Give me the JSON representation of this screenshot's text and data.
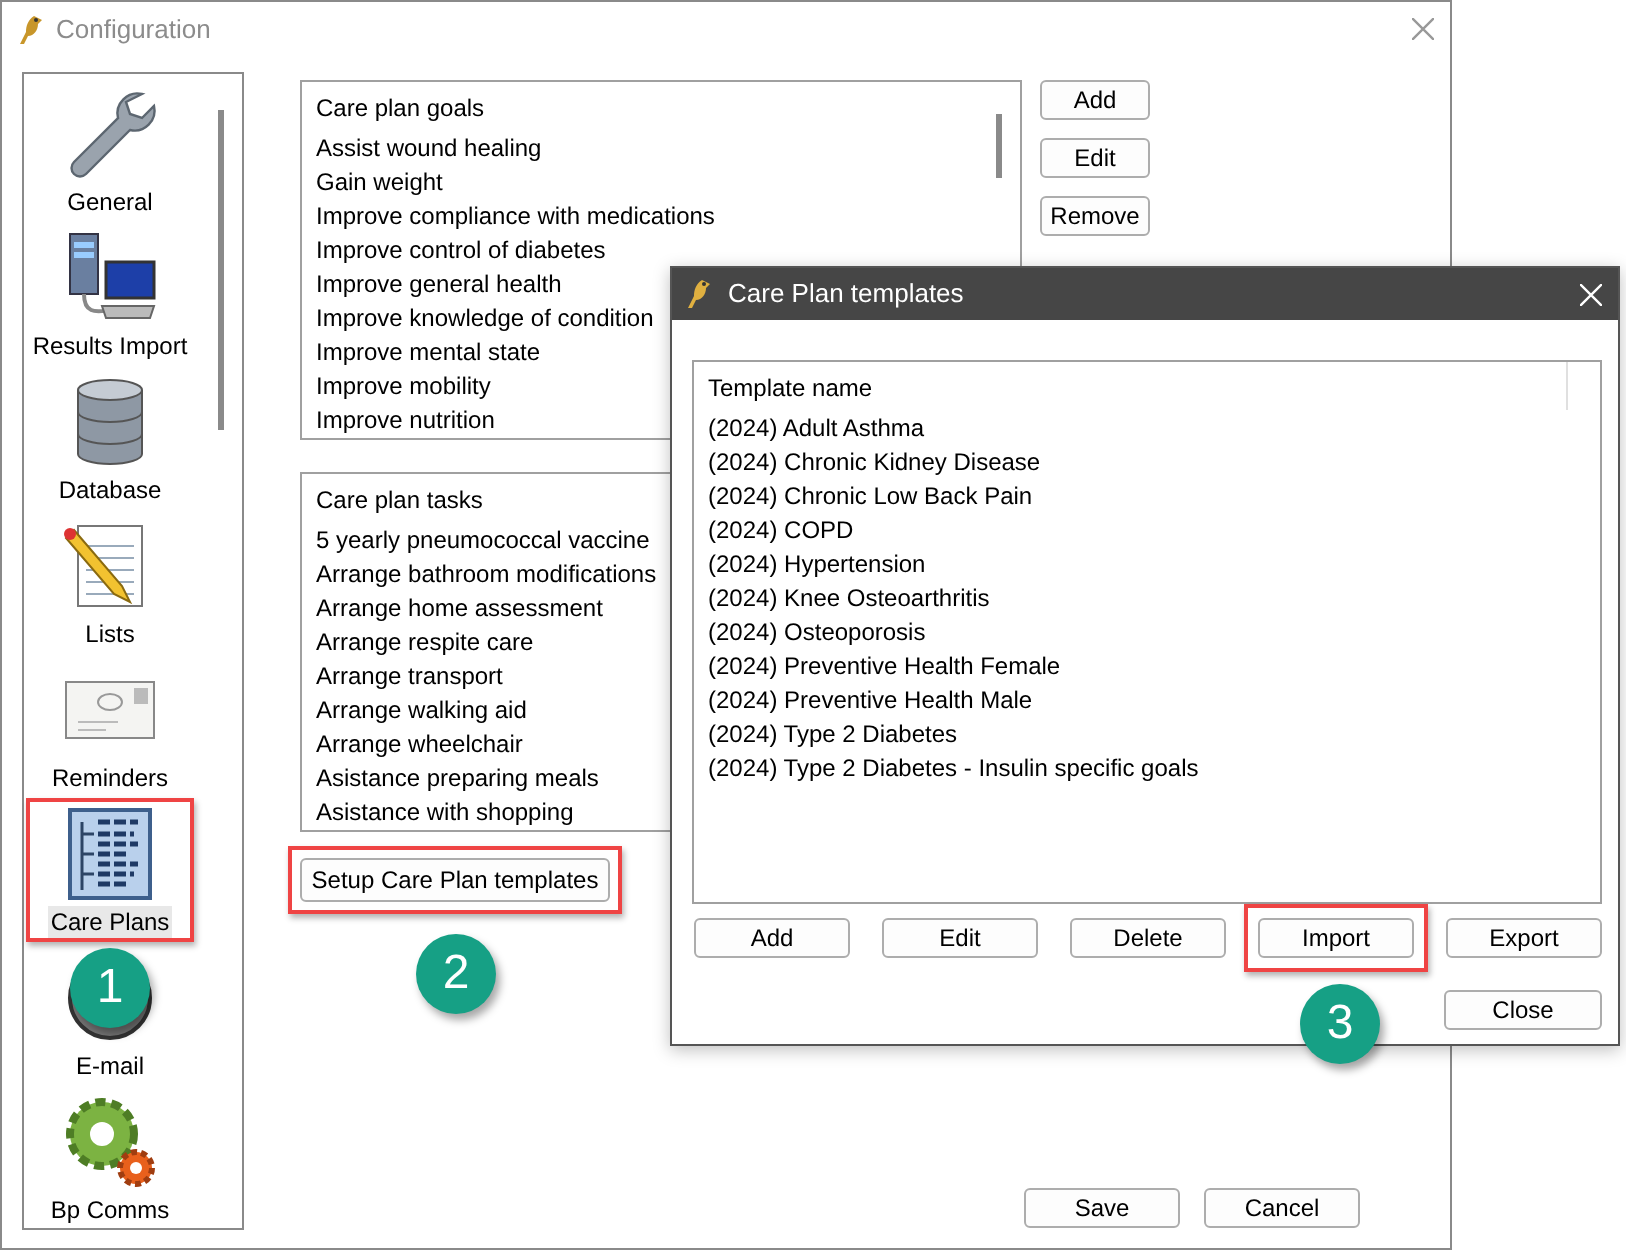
{
  "window": {
    "title": "Configuration"
  },
  "sidebar": {
    "items": [
      {
        "label": "General",
        "selected": false,
        "highlighted": false
      },
      {
        "label": "Results Import",
        "selected": false,
        "highlighted": false
      },
      {
        "label": "Database",
        "selected": false,
        "highlighted": false
      },
      {
        "label": "Lists",
        "selected": false,
        "highlighted": false
      },
      {
        "label": "Reminders",
        "selected": false,
        "highlighted": false
      },
      {
        "label": "Care Plans",
        "selected": true,
        "highlighted": true,
        "callout": "1"
      },
      {
        "label": "E-mail",
        "selected": false,
        "highlighted": false
      },
      {
        "label": "Bp Comms",
        "selected": false,
        "highlighted": false
      }
    ]
  },
  "goals": {
    "header": "Care plan goals",
    "items": [
      "Assist wound healing",
      "Gain weight",
      "Improve compliance with medications",
      "Improve control of diabetes",
      "Improve general health",
      "Improve knowledge of condition",
      "Improve mental state",
      "Improve mobility",
      "Improve nutrition"
    ]
  },
  "goal_buttons": [
    "Add",
    "Edit",
    "Remove"
  ],
  "tasks": {
    "header": "Care plan tasks",
    "items": [
      "5 yearly pneumococcal vaccine",
      "Arrange bathroom modifications",
      "Arrange home assessment",
      "Arrange respite care",
      "Arrange transport",
      "Arrange walking aid",
      "Arrange wheelchair",
      "Asistance preparing meals",
      "Asistance with shopping"
    ]
  },
  "setup_button": {
    "label": "Setup Care Plan templates",
    "highlighted": true,
    "callout": "2"
  },
  "footer_buttons": [
    "Save",
    "Cancel"
  ],
  "dialog": {
    "title": "Care Plan templates",
    "column": "Template name",
    "items": [
      "(2024) Adult Asthma",
      "(2024) Chronic Kidney Disease",
      "(2024) Chronic Low Back Pain",
      "(2024) COPD",
      "(2024) Hypertension",
      "(2024) Knee Osteoarthritis",
      "(2024) Osteoporosis",
      "(2024) Preventive Health Female",
      "(2024) Preventive Health Male",
      "(2024) Type 2 Diabetes",
      "(2024) Type 2 Diabetes - Insulin specific goals"
    ],
    "buttons": [
      {
        "label": "Add",
        "highlighted": false
      },
      {
        "label": "Edit",
        "highlighted": false
      },
      {
        "label": "Delete",
        "highlighted": false
      },
      {
        "label": "Import",
        "highlighted": true,
        "callout": "3"
      },
      {
        "label": "Export",
        "highlighted": false
      }
    ],
    "close_button": "Close"
  }
}
